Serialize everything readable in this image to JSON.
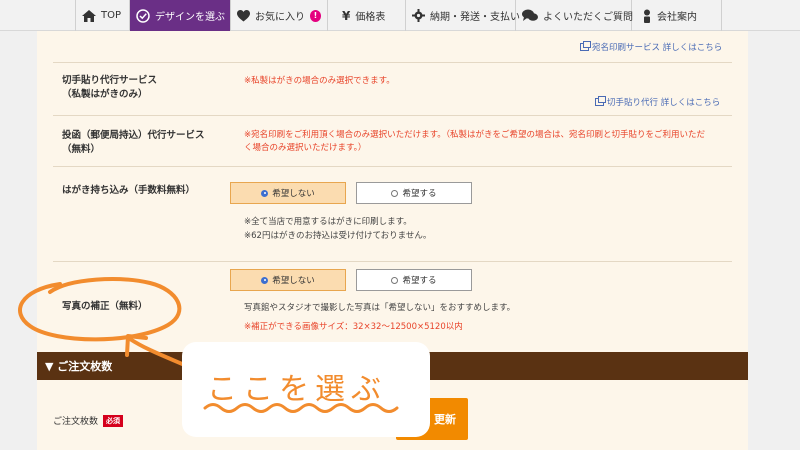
{
  "nav": {
    "items": [
      {
        "label": "TOP",
        "icon": "home-icon"
      },
      {
        "label": "デザインを選ぶ",
        "icon": "check-circle-icon",
        "active": true
      },
      {
        "label": "お気に入り",
        "icon": "heart-icon",
        "badge": "!"
      },
      {
        "label": "価格表",
        "icon": "yen-icon"
      },
      {
        "label": "納期・発送・支払い",
        "icon": "gear-icon"
      },
      {
        "label": "よくいただくご質問",
        "icon": "chat-bubbles-icon"
      },
      {
        "label": "会社案内",
        "icon": "person-icon"
      }
    ]
  },
  "form": {
    "address_link": "宛名印刷サービス 詳しくはこちら",
    "stamp": {
      "label_line1": "切手貼り代行サービス",
      "label_line2": "（私製はがきのみ）",
      "note": "※私製はがきの場合のみ選択できます。",
      "link": "切手貼り代行 詳しくはこちら"
    },
    "posting": {
      "label_line1": "投函（郵便局持込）代行サービス",
      "label_line2": "（無料）",
      "note_line1": "※宛名印刷をご利用頂く場合のみ選択いただけます。（私製はがきをご希望の場合は、宛名印刷と切手貼りをご利用いただ",
      "note_line2": "く場合のみ選択いただけます。）"
    },
    "bring": {
      "label": "はがき持ち込み（手数料無料）",
      "option_no": "希望しない",
      "option_yes": "希望する",
      "note_line1": "※全て当店で用意するはがきに印刷します。",
      "note_line2": "※62円はがきのお持込は受け付けておりません。"
    },
    "photo": {
      "label": "写真の補正（無料）",
      "option_no": "希望しない",
      "option_yes": "希望する",
      "note": "写真館やスタジオで撮影した写真は「希望しない」をおすすめします。",
      "note_red": "※補正ができる画像サイズ：32×32～12500×5120以内"
    }
  },
  "order": {
    "section_title": "▼ ご注文枚数",
    "qty_label": "ご注文枚数",
    "required_badge": "必須",
    "update_button": "更新"
  },
  "annotation": {
    "callout_text": "ここを選ぶ",
    "color": "#f28c2e"
  },
  "colors": {
    "nav_active": "#6a2f86",
    "panel_bg": "#fdf6ea",
    "section_bar": "#5a3212",
    "selected_option": "#fbdcb0",
    "update_button": "#f28a00",
    "required_badge": "#d5001c",
    "note_red": "#e8442a",
    "link": "#4a6bb5"
  }
}
